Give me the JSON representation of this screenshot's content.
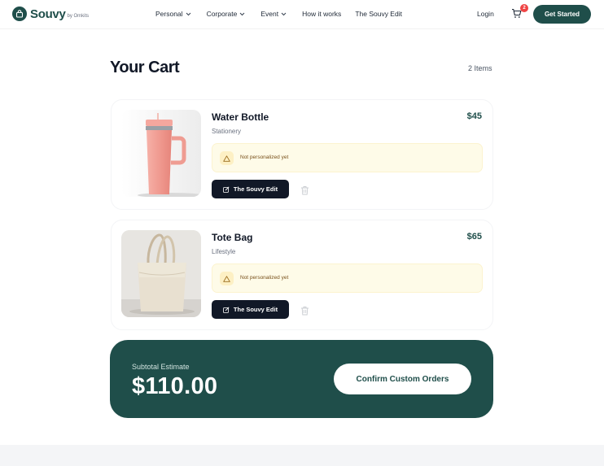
{
  "brand": {
    "name": "Souvy",
    "sub": "by Omkits",
    "icon": "bag-icon",
    "color": "#1f4e4a"
  },
  "nav": {
    "links": [
      {
        "label": "Personal",
        "dropdown": true
      },
      {
        "label": "Corporate",
        "dropdown": true
      },
      {
        "label": "Event",
        "dropdown": true
      },
      {
        "label": "How it works",
        "dropdown": false
      },
      {
        "label": "The Souvy Edit",
        "dropdown": false
      }
    ],
    "login": "Login",
    "cart_count": "2",
    "cta": "Get Started"
  },
  "cart": {
    "title": "Your Cart",
    "count_label": "2 Items",
    "items": [
      {
        "name": "Water Bottle",
        "category": "Stationery",
        "price": "$45",
        "notice": "Not personalized yet",
        "edit_label": "The Souvy Edit",
        "image": "pink-tumbler"
      },
      {
        "name": "Tote Bag",
        "category": "Lifestyle",
        "price": "$65",
        "notice": "Not personalized yet",
        "edit_label": "The Souvy Edit",
        "image": "canvas-tote"
      }
    ]
  },
  "summary": {
    "label": "Subtotal Estimate",
    "value": "$110.00",
    "confirm": "Confirm Custom Orders"
  },
  "colors": {
    "accent": "#1f4e4a",
    "badge": "#ef4444",
    "notice_bg": "#fefbe8",
    "dark_button": "#111827"
  }
}
